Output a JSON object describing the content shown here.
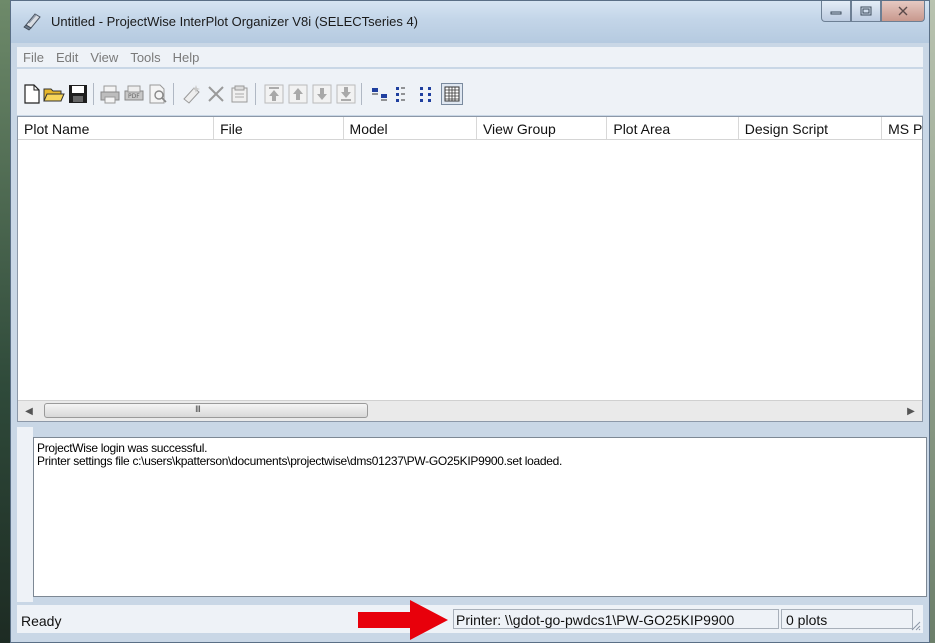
{
  "window": {
    "title": "Untitled - ProjectWise InterPlot Organizer V8i (SELECTseries 4)",
    "caption_buttons": [
      "minimize-icon",
      "maximize-icon",
      "close-icon"
    ]
  },
  "menu": {
    "items": [
      "File",
      "Edit",
      "View",
      "Tools",
      "Help"
    ]
  },
  "toolbar": {
    "buttons": [
      "new-icon",
      "open-folder-icon",
      "save-icon",
      "print-icon",
      "pdf-icon",
      "print-preview-icon",
      "add-plot-icon",
      "delete-icon",
      "properties-icon",
      "move-top-icon",
      "move-up-icon",
      "move-down-icon",
      "move-bottom-icon",
      "large-icons-view-icon",
      "small-icons-view-icon",
      "list-view-icon",
      "details-view-icon"
    ]
  },
  "grid": {
    "columns": [
      "Plot Name",
      "File",
      "Model",
      "View Group",
      "Plot Area",
      "Design Script",
      "MS P"
    ],
    "rows": [],
    "scroll_grip": "III"
  },
  "log": {
    "lines": [
      "ProjectWise login was successful.",
      "Printer settings file c:\\users\\kpatterson\\documents\\projectwise\\dms01237\\PW-GO25KIP9900.set loaded."
    ]
  },
  "status": {
    "ready": "Ready",
    "printer": "Printer: \\\\gdot-go-pwdcs1\\PW-GO25KIP9900",
    "plots": "0 plots"
  },
  "colors": {
    "annotation_arrow": "#e8000b",
    "window_frame": "#c9d7e6",
    "panel_bg": "#eef2f7"
  }
}
